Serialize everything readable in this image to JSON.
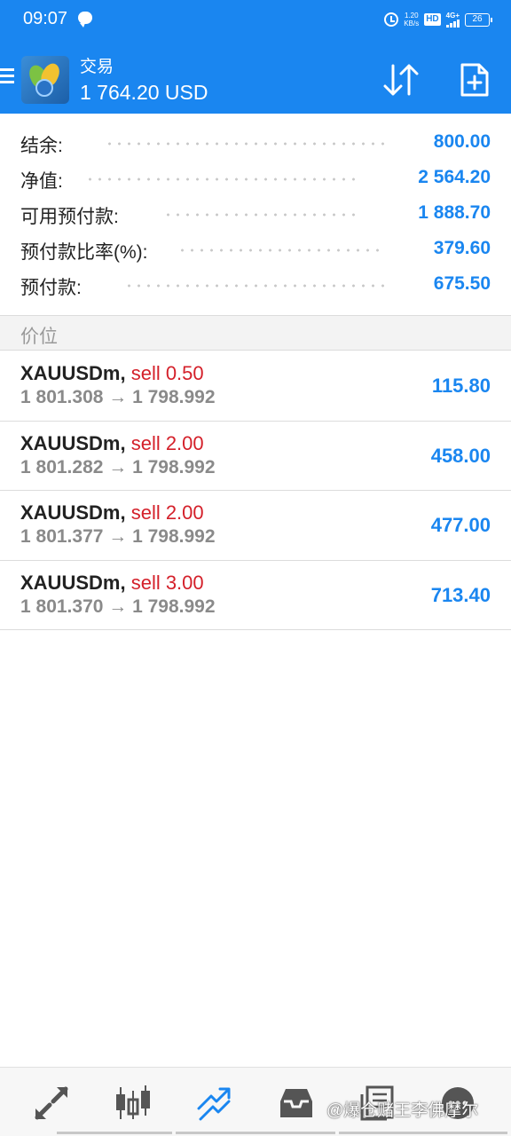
{
  "status_bar": {
    "time": "09:07",
    "net_speed_value": "1.20",
    "net_speed_unit": "KB/s",
    "hd_label": "HD",
    "signal_label": "4G+",
    "battery": "26"
  },
  "header": {
    "title": "交易",
    "balance": "1 764.20 USD"
  },
  "summary": [
    {
      "label": "结余:",
      "value": "800.00"
    },
    {
      "label": "净值:",
      "value": "2 564.20"
    },
    {
      "label": "可用预付款:",
      "value": "1 888.70"
    },
    {
      "label": "预付款比率(%):",
      "value": "379.60"
    },
    {
      "label": "预付款:",
      "value": "675.50"
    }
  ],
  "section_title": "价位",
  "positions": [
    {
      "symbol": "XAUUSDm,",
      "side": "sell 0.50",
      "prices": "1 801.308 → 1 798.992",
      "profit": "115.80"
    },
    {
      "symbol": "XAUUSDm,",
      "side": "sell 2.00",
      "prices": "1 801.282 → 1 798.992",
      "profit": "458.00"
    },
    {
      "symbol": "XAUUSDm,",
      "side": "sell 2.00",
      "prices": "1 801.377 → 1 798.992",
      "profit": "477.00"
    },
    {
      "symbol": "XAUUSDm,",
      "side": "sell 3.00",
      "prices": "1 801.370 → 1 798.992",
      "profit": "713.40"
    }
  ],
  "bottom_nav": {
    "items": [
      "quotes-icon",
      "chart-icon",
      "trade-icon",
      "history-icon",
      "news-icon",
      "messages-icon"
    ],
    "active": "trade-icon",
    "watermark": "@爆仓赌王李佛摩尔"
  },
  "colors": {
    "brand": "#1a86f0",
    "sell": "#d4202a",
    "value": "#1a86f0"
  }
}
